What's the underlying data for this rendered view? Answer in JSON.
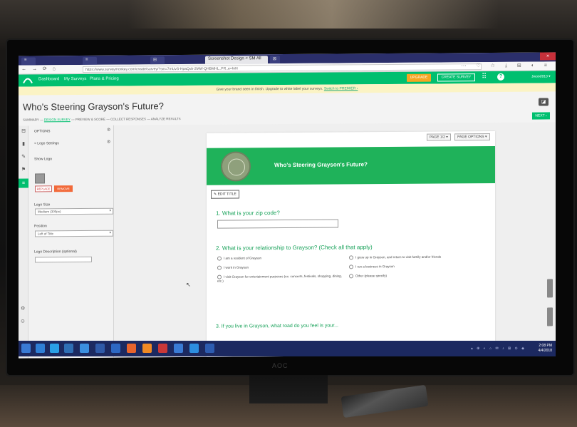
{
  "browser": {
    "tabs": [
      {
        "label": "≡"
      },
      {
        "label": "≡"
      },
      {
        "label": "⊞"
      },
      {
        "label": "Screenshot Design < SM All"
      },
      {
        "label": "⊠"
      }
    ],
    "url": "https://www.surveymonkey.com/create/survey/?sm=7mUvS-HpaQvb-2MW-QHBMHL..PR..e=hrN",
    "nav_icons": "← → ⟳ ⌂",
    "toolbar_right": "⋯ ♡ ☆   ⤓ ⊞ ◐ ≡",
    "close_label": "×"
  },
  "app_header": {
    "nav": [
      "Dashboard",
      "My Surveys",
      "Plans & Pricing"
    ],
    "upgrade_label": "UPGRADE",
    "create_label": "CREATE SURVEY",
    "grid_icon": "⠿",
    "help_icon": "?",
    "user_label": "Jwood910 ▾"
  },
  "banner": {
    "text": "Give your brand seen in finish. Upgrade to white label your surveys.",
    "link": "Switch to PREMIER ›"
  },
  "survey": {
    "title": "Who's Steering Grayson's Future?",
    "steps": [
      "SUMMARY",
      "DESIGN SURVEY",
      "PREVIEW & SCORE",
      "COLLECT RESPONSES",
      "ANALYZE RESULTS"
    ],
    "next_label": "NEXT ›",
    "comment_icon": "◪"
  },
  "left_panel": {
    "back_label": "< Logo Settings",
    "options_label": "OPTIONS",
    "show_logo": "Show Logo",
    "replace_label": "REPLACE",
    "remove_label": "REMOVE",
    "logo_size_label": "Logo Size",
    "logo_size_value": "Medium (300px)",
    "position_label": "Position",
    "position_value": "Left of Title",
    "description_label": "Logo Description (optional)"
  },
  "canvas": {
    "page_label": "PAGE 1/2",
    "page_options": "PAGE OPTIONS",
    "card_title": "Who's Steering Grayson's Future?",
    "edit_title": "✎ EDIT TITLE",
    "q1": "1. What is your zip code?",
    "q2": "2. What is your relationship to Grayson? (Check all that apply)",
    "q2_options_left": [
      "I am a resident of Grayson",
      "I work in Grayson",
      "I visit Grayson for entertainment purposes (ex. concerts, festivals, shopping, dining, etc.)"
    ],
    "q2_options_right": [
      "I grew up in Grayson, and return to visit family and/or friends",
      "I run a business in Grayson",
      "Other (please specify)"
    ],
    "q3": "3. If you live in Grayson, what road do you feel is your... "
  },
  "taskbar": {
    "tray": "▴ ⊕ ◐ ⌂ ✉ ♪ ⊞ ⊙ ◈",
    "time": "2:08 PM",
    "date": "4/4/2018"
  },
  "monitor_brand": "AOC",
  "colors": {
    "brand_green": "#00bf6f",
    "header_green": "#1fb25a",
    "upgrade_orange": "#f5a623",
    "remove_orange": "#f26a3a",
    "taskbar_blue": "#1c2960"
  }
}
